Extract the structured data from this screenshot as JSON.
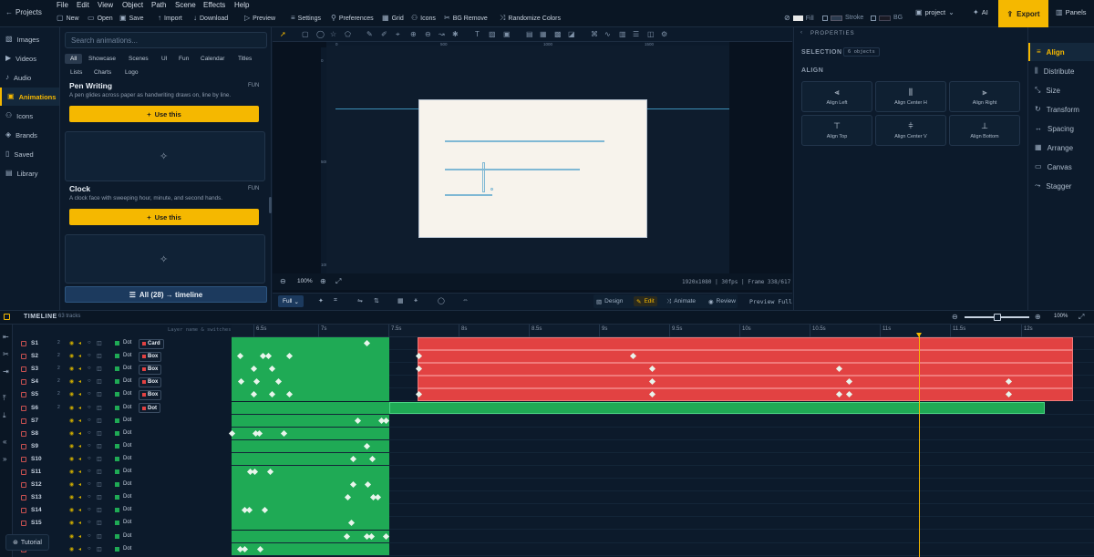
{
  "topbar": {
    "projects_label": "Projects",
    "menus": [
      "File",
      "Edit",
      "View",
      "Object",
      "Path",
      "Scene",
      "Effects",
      "Help"
    ],
    "actions": [
      "New",
      "Open",
      "Save",
      "Import",
      "Download",
      "Preview",
      "Settings",
      "Preferences",
      "Grid",
      "Icons",
      "BG Remove",
      "Randomize Colors"
    ],
    "fill_label": "Fill",
    "stroke_label": "Stroke",
    "bg_label": "BG",
    "project_label": "project",
    "ai_label": "AI",
    "export_label": "Export",
    "panels_label": "Panels"
  },
  "sidebar": {
    "items": [
      {
        "label": "Images",
        "icon": "image-icon"
      },
      {
        "label": "Videos",
        "icon": "video-icon"
      },
      {
        "label": "Audio",
        "icon": "audio-icon"
      },
      {
        "label": "Animations",
        "icon": "animation-icon"
      },
      {
        "label": "Icons",
        "icon": "icons-icon"
      },
      {
        "label": "Brands",
        "icon": "brand-icon"
      },
      {
        "label": "Saved",
        "icon": "bookmark-icon"
      },
      {
        "label": "Library",
        "icon": "library-icon"
      }
    ],
    "active": "Animations"
  },
  "library": {
    "search_placeholder": "Search animations...",
    "chips_row1": [
      "All",
      "Showcase",
      "Scenes",
      "UI",
      "Fun",
      "Calendar",
      "Titles"
    ],
    "chips_row2": [
      "Lists",
      "Charts",
      "Logo"
    ],
    "cards": [
      {
        "title": "Pen Writing",
        "tag": "FUN",
        "desc": "A pen glides across paper as handwriting draws on, line by line.",
        "button": "Use this"
      },
      {
        "title": "Clock",
        "tag": "FUN",
        "desc": "A clock face with sweeping hour, minute, and second hands.",
        "button": "Use this"
      }
    ],
    "all_to_timeline": "All (28) → timeline"
  },
  "canvas": {
    "ruler_top": [
      "0",
      "500",
      "1000",
      "1500"
    ],
    "ruler_left": [
      "0",
      "500",
      "1000"
    ],
    "zoom": "100%",
    "info": "1920x1080 | 30fps | Frame 338/617",
    "full_label": "Full",
    "modes": [
      "Design",
      "Edit",
      "Animate",
      "Review"
    ],
    "active_mode": "Edit",
    "preview_full": "Preview Full"
  },
  "properties": {
    "title": "PROPERTIES",
    "selection_label": "SELECTION",
    "selection_count": "6 objects",
    "align_title": "ALIGN",
    "align_buttons": [
      "Align Left",
      "Align Center H",
      "Align Right",
      "Align Top",
      "Align Center V",
      "Align Bottom"
    ]
  },
  "rightnav": {
    "items": [
      "Align",
      "Distribute",
      "Size",
      "Transform",
      "Spacing",
      "Arrange",
      "Canvas",
      "Stagger"
    ],
    "active": "Align"
  },
  "timeline": {
    "title": "TIMELINE",
    "track_count": "63 tracks",
    "hint": "Layer name & switches",
    "zoom": "100%",
    "ticks": [
      "6.5s",
      "7s",
      "7.5s",
      "8s",
      "8.5s",
      "9s",
      "9.5s",
      "10s",
      "10.5s",
      "11s",
      "11.5s",
      "12s"
    ],
    "tracks": [
      {
        "name": "S1",
        "num": "2",
        "type": "Dot",
        "badge": "Card"
      },
      {
        "name": "S2",
        "num": "2",
        "type": "Dot",
        "badge": "Box"
      },
      {
        "name": "S3",
        "num": "2",
        "type": "Dot",
        "badge": "Box"
      },
      {
        "name": "S4",
        "num": "2",
        "type": "Dot",
        "badge": "Box"
      },
      {
        "name": "S5",
        "num": "2",
        "type": "Dot",
        "badge": "Box"
      },
      {
        "name": "S6",
        "num": "2",
        "type": "Dot",
        "badge": "Dot"
      },
      {
        "name": "S7",
        "num": "",
        "type": "Dot",
        "badge": ""
      },
      {
        "name": "S8",
        "num": "",
        "type": "Dot",
        "badge": ""
      },
      {
        "name": "S9",
        "num": "",
        "type": "Dot",
        "badge": ""
      },
      {
        "name": "S10",
        "num": "",
        "type": "Dot",
        "badge": ""
      },
      {
        "name": "S11",
        "num": "",
        "type": "Dot",
        "badge": ""
      },
      {
        "name": "S12",
        "num": "",
        "type": "Dot",
        "badge": ""
      },
      {
        "name": "S13",
        "num": "",
        "type": "Dot",
        "badge": ""
      },
      {
        "name": "S14",
        "num": "",
        "type": "Dot",
        "badge": ""
      },
      {
        "name": "S15",
        "num": "",
        "type": "Dot",
        "badge": ""
      },
      {
        "name": "",
        "num": "",
        "type": "Dot",
        "badge": ""
      },
      {
        "name": "",
        "num": "",
        "type": "Dot",
        "badge": ""
      }
    ]
  },
  "tutorial_label": "Tutorial",
  "colors": {
    "accent": "#f5b800",
    "green": "#1faa55",
    "red": "#e24242",
    "bg": "#0c1a2b"
  }
}
